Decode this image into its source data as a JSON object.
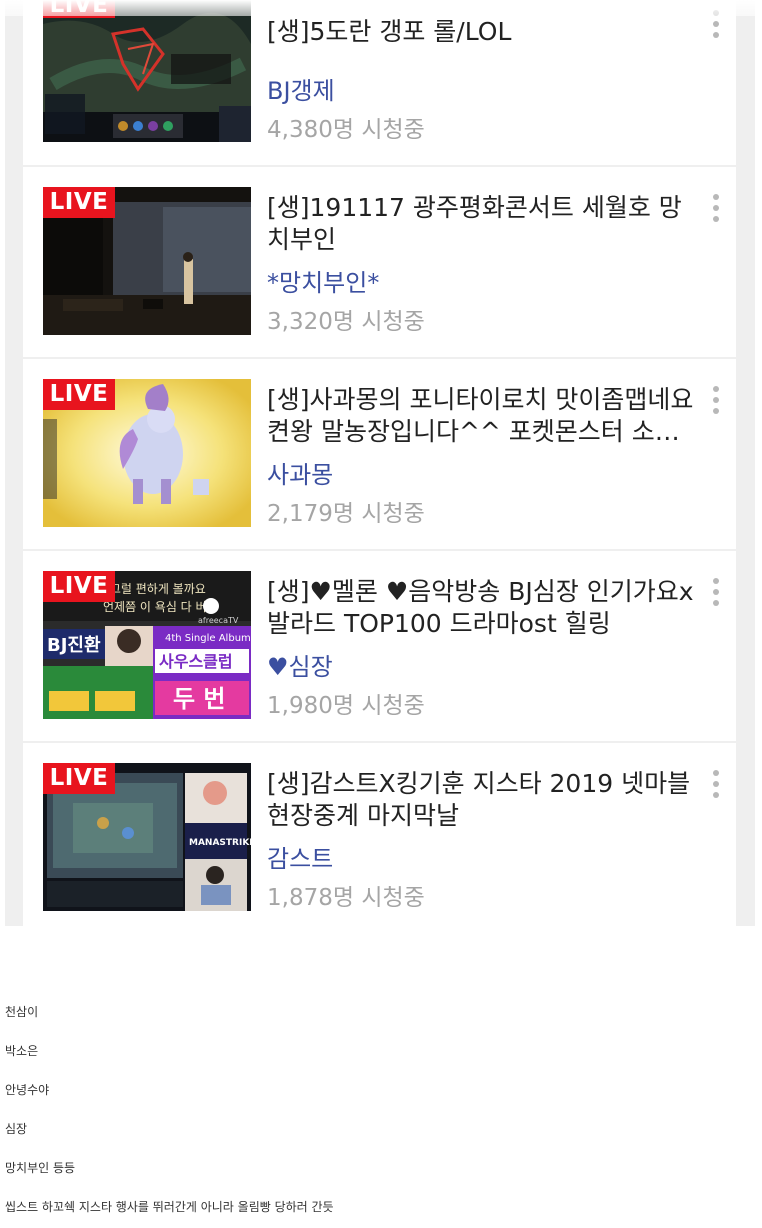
{
  "live_badge": "LIVE",
  "streams": [
    {
      "title": "[생]5도란 갱포  롤/LOL",
      "bj": "BJ갱제",
      "viewers": "4,380명 시청중"
    },
    {
      "title": "[생]191117 광주평화콘서트 세월호 망치부인",
      "bj": "*망치부인*",
      "viewers": "3,320명 시청중"
    },
    {
      "title": "[생]사과몽의 포니타이로치 맛이좀맵네요 켠왕 말농장입니다^^ 포켓몬스터 소드 실드",
      "bj": "사과몽",
      "viewers": "2,179명 시청중"
    },
    {
      "title": "[생]♥멜론 ♥음악방송 BJ심장 인기가요x 발라드 TOP100 드라마ost 힐링",
      "bj": "♥심장",
      "viewers": "1,980명 시청중"
    },
    {
      "title": "[생]감스트X킹기훈 지스타 2019 넷마블 현장중계 마지막날",
      "bj": "감스트",
      "viewers": "1,878명 시청중"
    }
  ],
  "thumb4_text": {
    "top_line1": "쫌 그럴 편하게 볼까요",
    "top_line2": "언제쯤 이 욕심 다 버릴",
    "bj_name": "BJ진환",
    "logo": "afreecaTV",
    "album": "4th Single Album",
    "club": "사우스클럽",
    "song": "두 번"
  },
  "thumb5_text": {
    "logo": "MANASTRIKE"
  },
  "comments": [
    "천삼이",
    "박소은",
    "안녕수야",
    "심장",
    "망치부인 등등",
    "씹스트 하꼬쉑 지스타 행사를 뛰러간게 아니라 올림빵 당하러 간듯"
  ]
}
